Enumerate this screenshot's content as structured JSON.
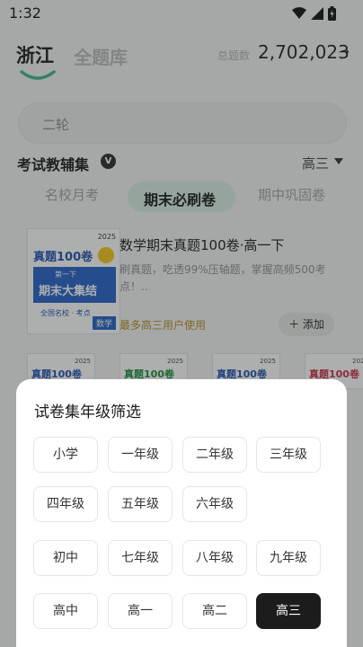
{
  "status_bar": {
    "time": "1:32"
  },
  "header": {
    "tab_region": "浙江",
    "tab_library": "全题库",
    "total_label": "总题数",
    "total_value": "2,702,023",
    "total_arrow": "→"
  },
  "search": {
    "placeholder": "二轮"
  },
  "section": {
    "title": "考试教辅集",
    "badge": "V",
    "grade_filter": "高三"
  },
  "category_tabs": [
    {
      "label": "名校月考"
    },
    {
      "label": "期末必刷卷"
    },
    {
      "label": "期中巩固卷"
    }
  ],
  "book": {
    "title": "数学期末真题100卷·高一下",
    "description": "刷真题，吃透99%压轴题，掌握高频500考点！..",
    "users": "最多高三用户使用",
    "add_label": "＋ 添加",
    "cover": {
      "title": "真题100卷",
      "year": "2025",
      "banner_small": "第一下",
      "banner_big": "期末大集结",
      "sub": "全国名校 · 考点",
      "subject": "数学"
    }
  },
  "thumbs": [
    {
      "title": "真题100卷",
      "year": "2025",
      "color": "#1f4fb0"
    },
    {
      "title": "真题100卷",
      "year": "2025",
      "color": "#1e8a3c"
    },
    {
      "title": "真题100卷",
      "year": "2025",
      "color": "#1f4fb0"
    },
    {
      "title": "真题100卷",
      "year": "2025",
      "color": "#c8304a"
    }
  ],
  "sheet": {
    "title": "试卷集年级筛选",
    "rows": [
      [
        "小学",
        "一年级",
        "二年级",
        "三年级"
      ],
      [
        "四年级",
        "五年级",
        "六年级"
      ],
      [
        "初中",
        "七年级",
        "八年级",
        "九年级"
      ],
      [
        "高中",
        "高一",
        "高二",
        "高三"
      ]
    ],
    "selected": "高三"
  },
  "colors": {
    "accent_green": "#3fb48a",
    "selected_chip": "#1c1c1c",
    "users_gold": "#b98a22"
  }
}
